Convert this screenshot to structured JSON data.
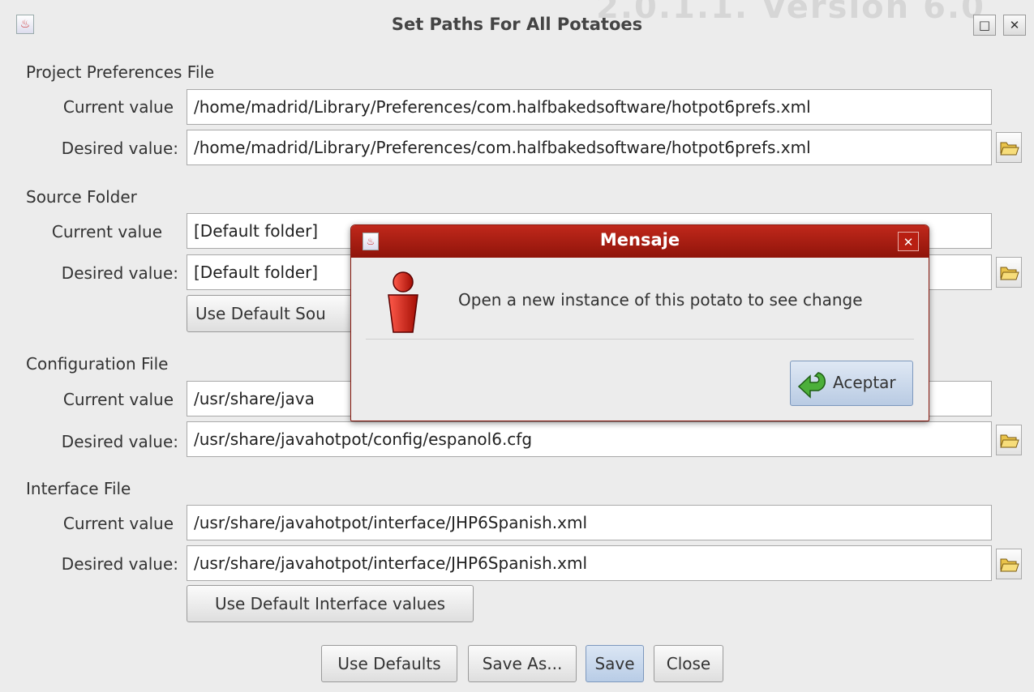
{
  "window": {
    "title": "Set Paths For All Potatoes",
    "ghost_text": "2.0.1.1. Version 6.0",
    "maximize_glyph": "□",
    "close_glyph": "✕"
  },
  "sections": {
    "prefs": {
      "title": "Project Preferences File",
      "current_label": "Current value",
      "current_value": "/home/madrid/Library/Preferences/com.halfbakedsoftware/hotpot6prefs.xml",
      "desired_label": "Desired value:",
      "desired_value": "/home/madrid/Library/Preferences/com.halfbakedsoftware/hotpot6prefs.xml"
    },
    "source": {
      "title": "Source Folder",
      "current_label": "Current value",
      "current_value": "[Default folder]",
      "desired_label": "Desired value:",
      "desired_value": "[Default folder]",
      "default_button": "Use Default Sou"
    },
    "config": {
      "title": "Configuration File",
      "current_label": "Current value",
      "current_value": "/usr/share/java",
      "desired_label": "Desired value:",
      "desired_value": "/usr/share/javahotpot/config/espanol6.cfg"
    },
    "interface": {
      "title": "Interface File",
      "current_label": "Current value",
      "current_value": "/usr/share/javahotpot/interface/JHP6Spanish.xml",
      "desired_label": "Desired value:",
      "desired_value": "/usr/share/javahotpot/interface/JHP6Spanish.xml",
      "default_button": "Use Default Interface values"
    }
  },
  "bottom_buttons": {
    "use_defaults": "Use Defaults",
    "save_as": "Save As...",
    "save": "Save",
    "close": "Close"
  },
  "dialog": {
    "title": "Mensaje",
    "close_glyph": "✕",
    "message": "Open a new instance of this potato to see change",
    "ok_button": "Aceptar"
  },
  "icons": {
    "folder": "open-folder-icon",
    "info": "info-icon",
    "ok": "green-return-arrow-icon"
  },
  "colors": {
    "dialog_title_bg": "#a51c10",
    "window_bg": "#ececec",
    "primary_button": "#b8cce6"
  }
}
